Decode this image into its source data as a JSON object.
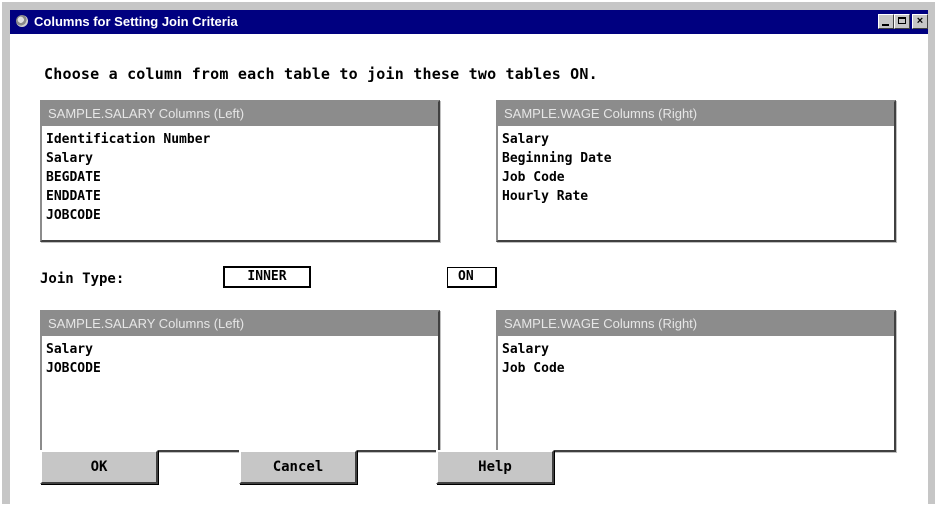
{
  "window": {
    "title": "Columns for Setting Join Criteria",
    "icon": "sas-globe-icon",
    "controls": {
      "minimize": "minimize-icon",
      "maximize": "maximize-icon",
      "close": "×"
    }
  },
  "instruction": "Choose a column from each table to join these two tables ON.",
  "top": {
    "left": {
      "header": "SAMPLE.SALARY Columns (Left)",
      "items": [
        "Identification Number",
        "Salary",
        "BEGDATE",
        "ENDDATE",
        "JOBCODE"
      ]
    },
    "right": {
      "header": "SAMPLE.WAGE Columns (Right)",
      "items": [
        "Salary",
        "Beginning Date",
        "Job Code",
        "Hourly Rate"
      ]
    }
  },
  "join": {
    "label": "Join Type:",
    "type": "INNER",
    "on": "ON"
  },
  "bottom": {
    "left": {
      "header": "SAMPLE.SALARY Columns (Left)",
      "items": [
        "Salary",
        "JOBCODE"
      ]
    },
    "right": {
      "header": "SAMPLE.WAGE Columns (Right)",
      "items": [
        "Salary",
        "Job Code"
      ]
    }
  },
  "buttons": {
    "ok": "OK",
    "cancel": "Cancel",
    "help": "Help"
  },
  "colors": {
    "titlebar": "#000080",
    "window_bg": "#c6c6c6",
    "listbox_header": "#8c8c8c",
    "content_bg": "#ffffff"
  }
}
